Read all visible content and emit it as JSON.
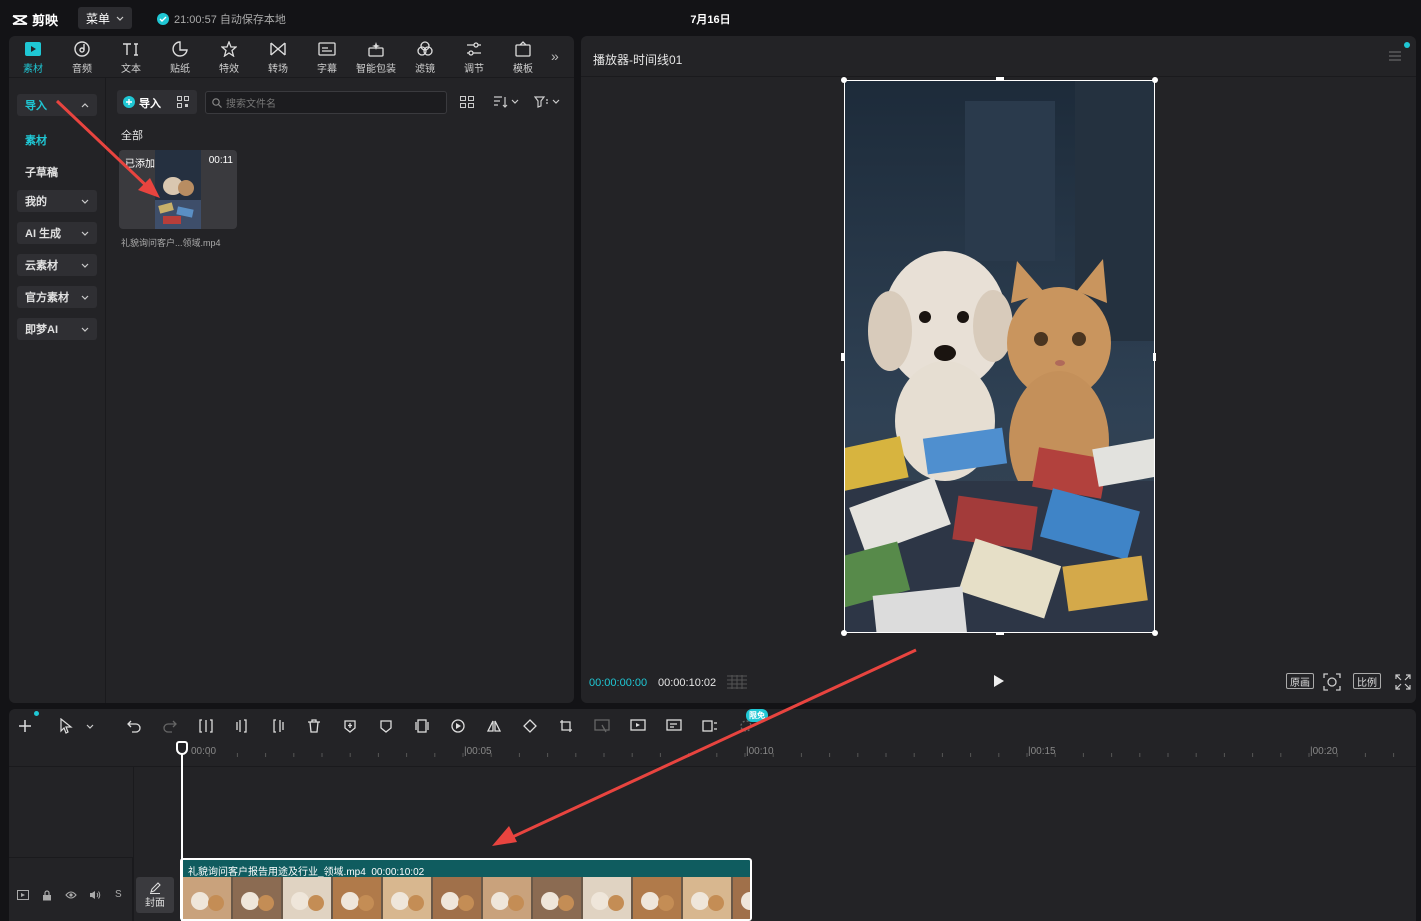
{
  "app": {
    "name": "剪映",
    "menu_label": "菜单",
    "save_status": "21:00:57 自动保存本地",
    "project_title": "7月16日"
  },
  "tabs": [
    {
      "label": "素材",
      "icon": "media-play-icon",
      "active": true
    },
    {
      "label": "音频",
      "icon": "audio-disc-icon"
    },
    {
      "label": "文本",
      "icon": "text-ti-icon"
    },
    {
      "label": "贴纸",
      "icon": "sticker-icon"
    },
    {
      "label": "特效",
      "icon": "effects-star-icon"
    },
    {
      "label": "转场",
      "icon": "transition-bowtie-icon"
    },
    {
      "label": "字幕",
      "icon": "subtitle-icon"
    },
    {
      "label": "智能包装",
      "icon": "smart-package-icon"
    },
    {
      "label": "滤镜",
      "icon": "filter-icon"
    },
    {
      "label": "调节",
      "icon": "adjust-sliders-icon"
    },
    {
      "label": "模板",
      "icon": "template-icon"
    }
  ],
  "sidebar": {
    "import": "导入",
    "material": "素材",
    "sub_draft": "子草稿",
    "mine": "我的",
    "ai_gen": "AI 生成",
    "cloud": "云素材",
    "official": "官方素材",
    "jimeng": "即梦AI"
  },
  "media": {
    "import_btn": "导入",
    "search_placeholder": "搜索文件名",
    "section_all": "全部",
    "card": {
      "added_label": "已添加",
      "duration": "00:11",
      "filename": "礼貌询问客户...领域.mp4"
    }
  },
  "player": {
    "title": "播放器-时间线01",
    "current_time": "00:00:00:00",
    "total_time": "00:00:10:02",
    "btn_original": "原画",
    "btn_ratio": "比例"
  },
  "timeline": {
    "ticks": [
      "00:00",
      "|00:05",
      "|00:10",
      "|00:15",
      "|00:20"
    ],
    "free_badge": "限免",
    "cover_label": "封面",
    "clip_name": "礼貌询问客户报告用途及行业_领域.mp4",
    "clip_duration": "00:00:10:02",
    "track_s": "S"
  },
  "colors": {
    "accent": "#1fc7d4",
    "clip_bg": "#0f5c5f",
    "annotation_arrow": "#e8443f"
  }
}
